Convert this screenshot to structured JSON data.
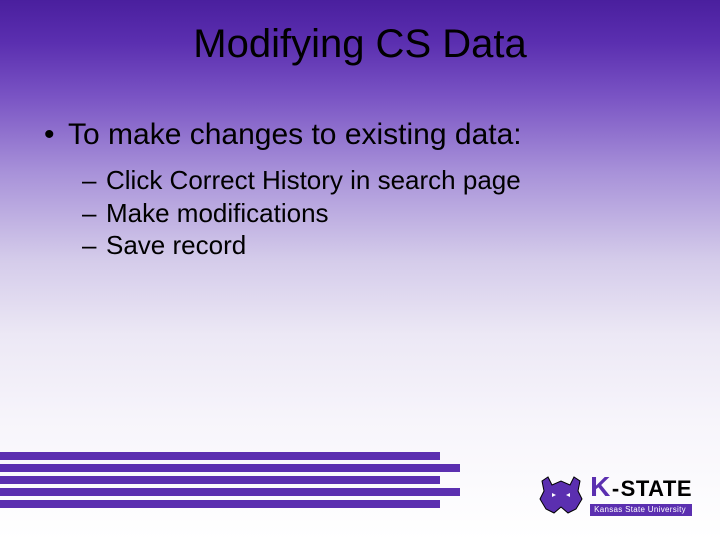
{
  "title": "Modifying CS Data",
  "bullets": {
    "level1": {
      "marker": "•",
      "text": "To make changes to existing data:"
    },
    "level2": [
      {
        "marker": "–",
        "text": "Click Correct History in search page"
      },
      {
        "marker": "–",
        "text": "Make modifications"
      },
      {
        "marker": "–",
        "text": "Save record"
      }
    ]
  },
  "logo": {
    "k": "K",
    "dash": "-",
    "state": "STATE",
    "university": "Kansas State University"
  },
  "colors": {
    "brand_purple": "#5b2fb0"
  }
}
